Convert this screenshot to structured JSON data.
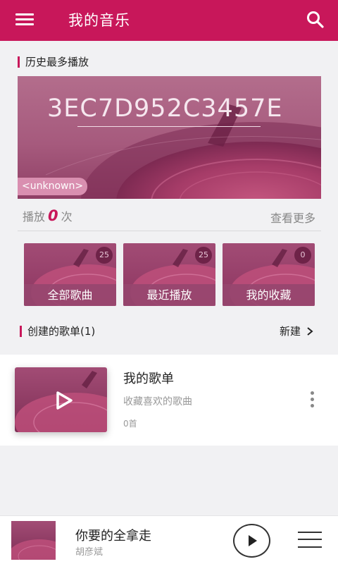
{
  "header": {
    "title": "我的音乐",
    "menu_icon": "menu-icon",
    "search_icon": "search-icon"
  },
  "history": {
    "section_title": "历史最多播放",
    "song_id": "3EC7D952C3457E",
    "artist_tag": "<unknown>",
    "plays_prefix": "播放",
    "plays_count": "0",
    "plays_suffix": "次",
    "more_label": "查看更多"
  },
  "tiles": [
    {
      "label": "全部歌曲",
      "count": "25"
    },
    {
      "label": "最近播放",
      "count": "25"
    },
    {
      "label": "我的收藏",
      "count": "0"
    }
  ],
  "playlists_section": {
    "title": "创建的歌单(1)",
    "new_label": "新建"
  },
  "playlist": {
    "title": "我的歌单",
    "description": "收藏喜欢的歌曲",
    "count": "0首"
  },
  "player": {
    "title": "你要的全拿走",
    "artist": "胡彦斌"
  },
  "colors": {
    "accent": "#c8175a",
    "background": "#f1f1f3"
  }
}
